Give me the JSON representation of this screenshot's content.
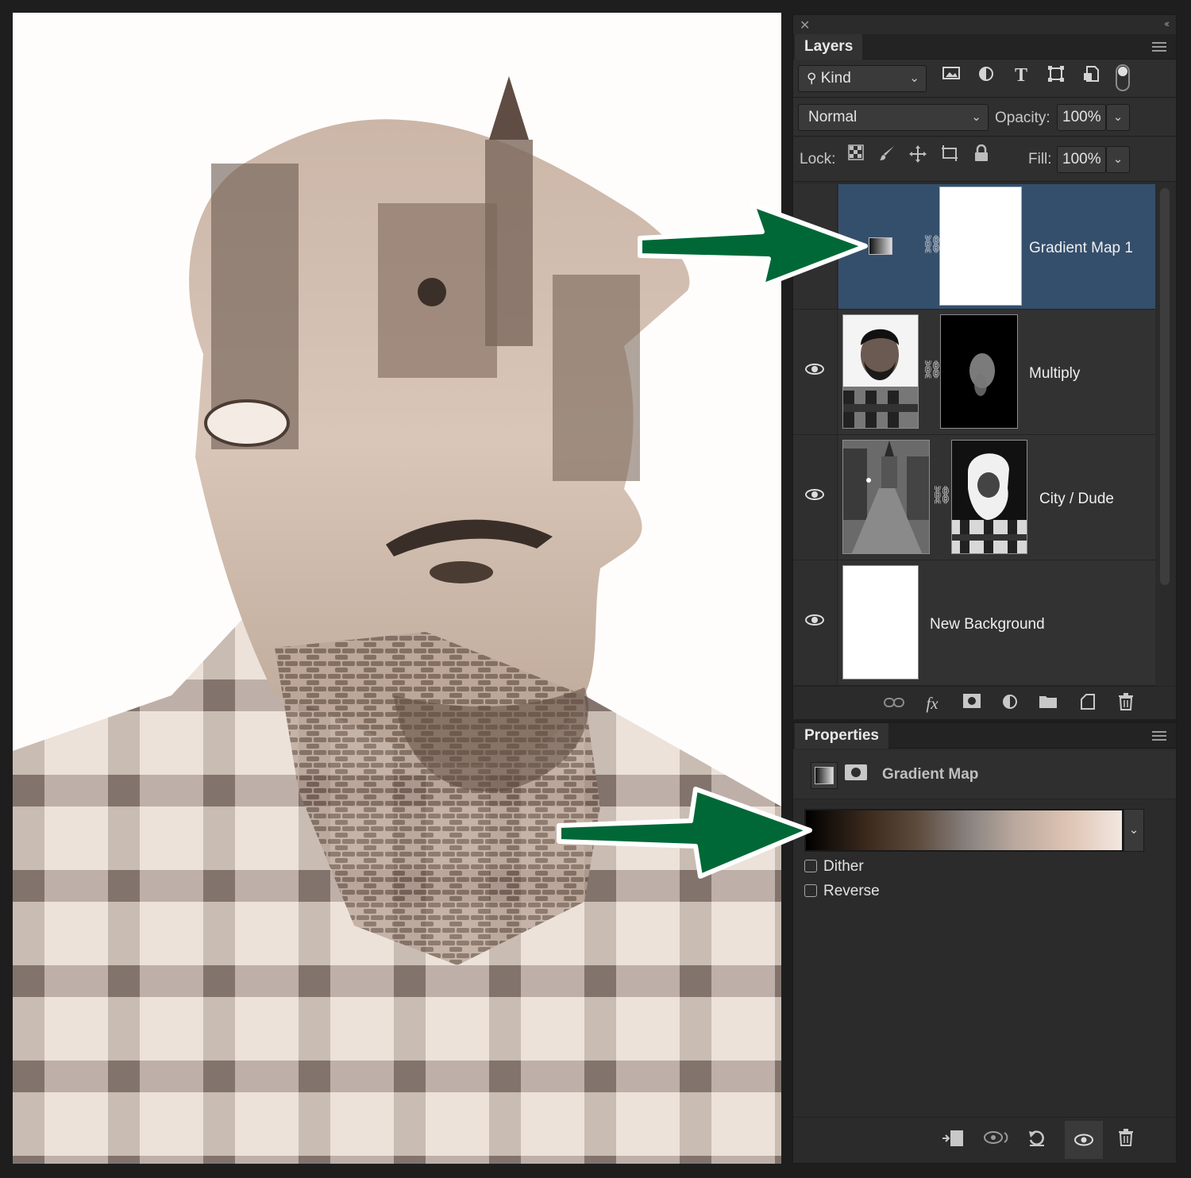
{
  "layers_panel": {
    "tab_label": "Layers",
    "filter": {
      "label": "Kind",
      "icons": [
        "image-filter-icon",
        "adjustment-filter-icon",
        "type-filter-icon",
        "shape-filter-icon",
        "smart-object-filter-icon"
      ],
      "type_glyph": "T"
    },
    "blend_mode": "Normal",
    "opacity_label": "Opacity:",
    "opacity_value": "100%",
    "lock_label": "Lock:",
    "fill_label": "Fill:",
    "fill_value": "100%",
    "layers": [
      {
        "name": "Gradient Map 1",
        "selected": true,
        "visible": false
      },
      {
        "name": "Multiply",
        "selected": false,
        "visible": true
      },
      {
        "name": "City / Dude",
        "selected": false,
        "visible": true
      },
      {
        "name": "New Background",
        "selected": false,
        "visible": true
      }
    ],
    "fx_label": "fx"
  },
  "properties_panel": {
    "tab_label": "Properties",
    "title": "Gradient Map",
    "gradient_colors": [
      "#000000",
      "#3d2b1e",
      "#8a8481",
      "#dcc2b2",
      "#f3e7df"
    ],
    "dither_label": "Dither",
    "dither_checked": false,
    "reverse_label": "Reverse",
    "reverse_checked": false
  },
  "colors": {
    "panel_bg": "#2b2b2b",
    "selected_layer": "#344f6c",
    "arrow_green": "#006837",
    "canvas_bg": "#fffdfb"
  }
}
